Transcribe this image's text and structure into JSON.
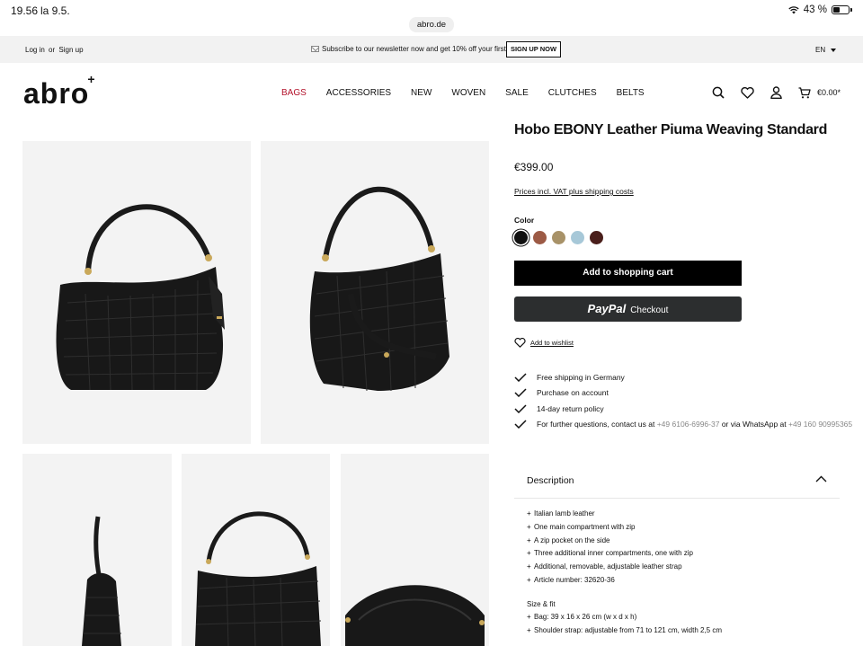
{
  "status_bar": {
    "time": "19.56",
    "date": "la 9.5.",
    "battery": "43 %"
  },
  "browser": {
    "url": "abro.de"
  },
  "announcement": {
    "login": "Log in",
    "or": "or",
    "signup": "Sign up",
    "newsletter": "Subscribe to our newsletter now and get 10% off your first order!",
    "signup_button": "SIGN UP NOW",
    "language": "EN"
  },
  "header": {
    "logo": "abro",
    "logo_mark": "+",
    "nav": [
      "BAGS",
      "ACCESSORIES",
      "NEW",
      "WOVEN",
      "SALE",
      "CLUTCHES",
      "BELTS"
    ],
    "active_nav": "BAGS",
    "cart_total": "€0.00*"
  },
  "product": {
    "title": "Hobo EBONY Leather Piuma Weaving Standard",
    "price": "€399.00",
    "vat_note": "Prices incl. VAT plus shipping costs",
    "color_label": "Color",
    "colors": [
      {
        "name": "black",
        "hex": "#111111",
        "selected": true
      },
      {
        "name": "cognac",
        "hex": "#9c5a45",
        "selected": false
      },
      {
        "name": "taupe",
        "hex": "#a89268",
        "selected": false
      },
      {
        "name": "light blue",
        "hex": "#a7c8d8",
        "selected": false
      },
      {
        "name": "dark brown",
        "hex": "#4a1f1b",
        "selected": false
      }
    ],
    "add_to_cart": "Add to shopping cart",
    "paypal_brand": "PayPal",
    "paypal_label": "Checkout",
    "wishlist": "Add to wishlist"
  },
  "benefits": {
    "shipping": "Free shipping in Germany",
    "account": "Purchase on account",
    "returns": "14-day return policy",
    "contact_prefix": "For further questions, contact us at",
    "phone": "+49 6106-6996-37",
    "whatsapp_prefix": "or via WhatsApp at",
    "whatsapp": "+49 160 90995365"
  },
  "description": {
    "title": "Description",
    "features": [
      "Italian lamb leather",
      "One main compartment with zip",
      "A zip pocket on the side",
      "Three additional inner compartments, one with zip",
      "Additional,  removable, adjustable leather strap",
      "Article number: 32620-36"
    ],
    "size_fit_label": "Size & fit",
    "sizes": [
      "Bag: 39 x 16 x 26 cm (w x d x h)",
      "Shoulder strap: adjustable from 71 to 121 cm, width 2,5 cm"
    ]
  }
}
